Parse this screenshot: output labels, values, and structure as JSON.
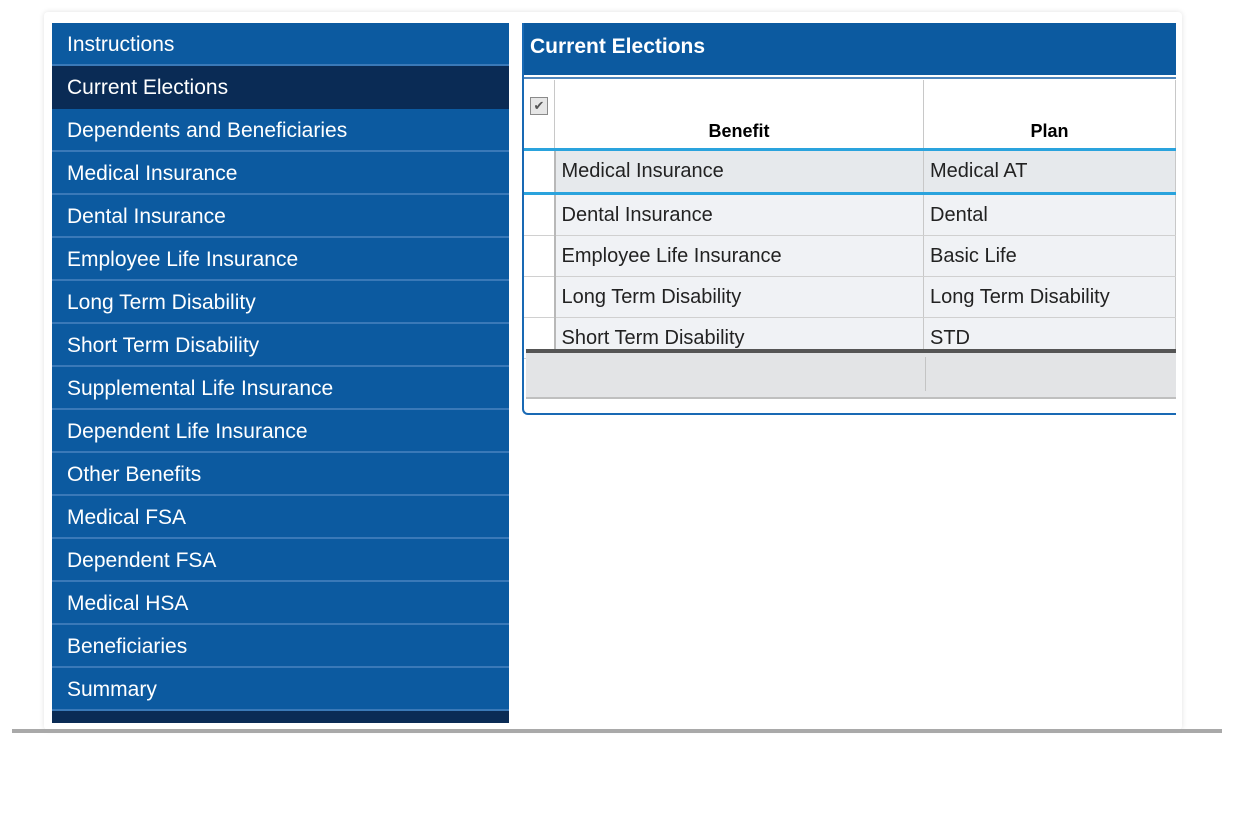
{
  "sidebar": {
    "items": [
      {
        "label": "Instructions"
      },
      {
        "label": "Current Elections"
      },
      {
        "label": "Dependents and Beneficiaries"
      },
      {
        "label": "Medical Insurance"
      },
      {
        "label": "Dental Insurance"
      },
      {
        "label": "Employee Life Insurance"
      },
      {
        "label": "Long Term Disability"
      },
      {
        "label": "Short Term Disability"
      },
      {
        "label": "Supplemental Life Insurance"
      },
      {
        "label": "Dependent Life Insurance"
      },
      {
        "label": "Other Benefits"
      },
      {
        "label": "Medical FSA"
      },
      {
        "label": "Dependent FSA"
      },
      {
        "label": "Medical HSA"
      },
      {
        "label": "Beneficiaries"
      },
      {
        "label": "Summary"
      }
    ],
    "active_index": 1
  },
  "panel": {
    "title": "Current Elections",
    "table": {
      "columns": [
        "Benefit",
        "Plan"
      ],
      "rows": [
        {
          "benefit": "Medical Insurance",
          "plan": "Medical AT"
        },
        {
          "benefit": "Dental Insurance",
          "plan": "Dental"
        },
        {
          "benefit": "Employee Life Insurance",
          "plan": "Basic Life"
        },
        {
          "benefit": "Long Term Disability",
          "plan": "Long Term Disability"
        },
        {
          "benefit": "Short Term Disability",
          "plan": "STD"
        }
      ],
      "selected_row": 0
    }
  },
  "colors": {
    "sidebar_bg": "#0c5aa0",
    "active_bg": "#0a2b55",
    "selection_accent": "#2aa3dd"
  },
  "icons": {
    "select_all": "checkbox-check-icon"
  }
}
